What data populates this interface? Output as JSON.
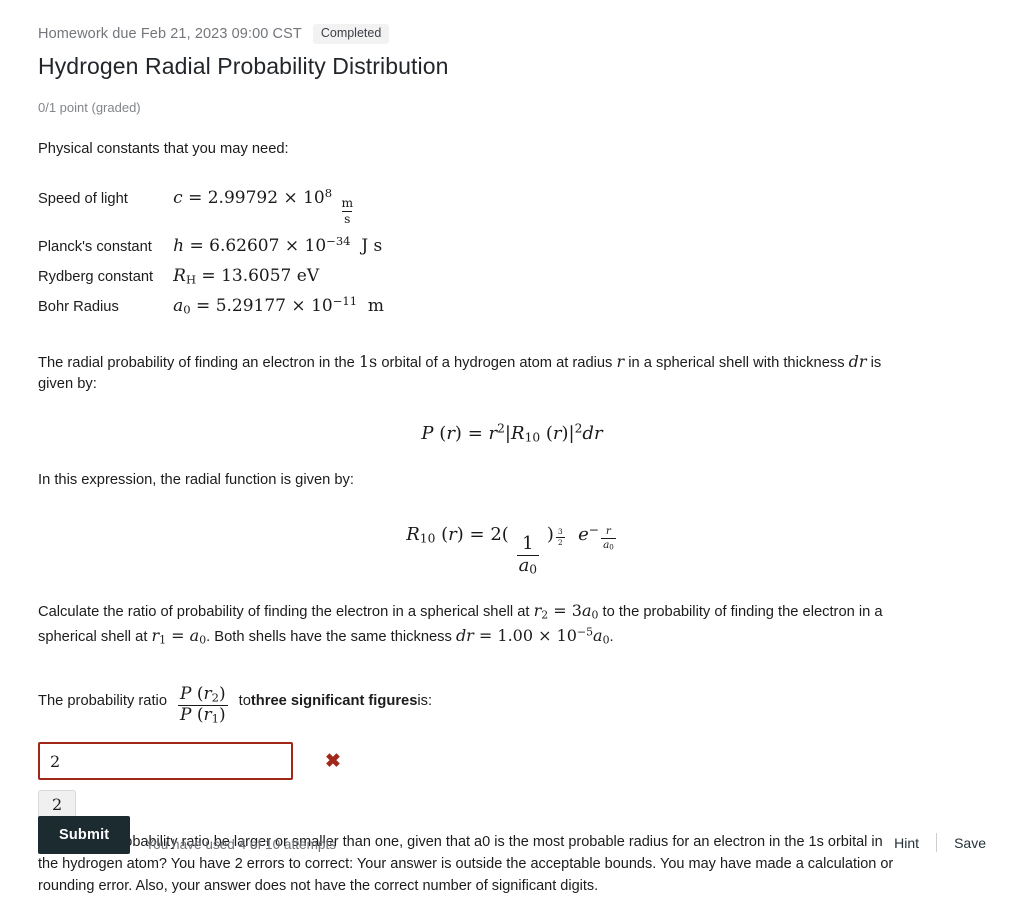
{
  "header": {
    "due_text": "Homework due Feb 21, 2023 09:00 CST",
    "status_badge": "Completed",
    "title": "Hydrogen Radial Probability Distribution",
    "points": "0/1 point (graded)"
  },
  "intro": {
    "constants_heading": "Physical constants that you may need:"
  },
  "constants": [
    {
      "label": "Speed of light",
      "symbol": "c",
      "value": "2.99792 × 10⁸ m/s"
    },
    {
      "label": "Planck's constant",
      "symbol": "h",
      "value": "6.62607 × 10⁻³⁴ J s"
    },
    {
      "label": "Rydberg constant",
      "symbol": "R_H",
      "value": "13.6057 eV"
    },
    {
      "label": "Bohr Radius",
      "symbol": "a_0",
      "value": "5.29177 × 10⁻¹¹ m"
    }
  ],
  "problem": {
    "paragraph1_a": "The radial probability of finding an electron in the ",
    "paragraph1_orbital": "1s",
    "paragraph1_b": " orbital of a hydrogen atom at radius ",
    "paragraph1_r": "r",
    "paragraph1_c": " in a spherical shell with thickness ",
    "paragraph1_dr": "dr",
    "paragraph1_d": " is given by:",
    "equation1": "P (r) = r² |R₁₀ (r)|² dr",
    "paragraph2": "In this expression, the radial function is given by:",
    "equation2": "R₁₀ (r) = 2(1/a₀)^(3/2) e^(−r/a₀)",
    "paragraph3_a": "Calculate the ratio of probability of finding the electron in a spherical shell at ",
    "paragraph3_r2": "r₂ = 3a₀",
    "paragraph3_b": " to the probability of finding the electron in a spherical shell at ",
    "paragraph3_r1": "r₁ = a₀",
    "paragraph3_c": ". Both shells have the same thickness ",
    "paragraph3_dr": "dr = 1.00 × 10⁻⁵ a₀",
    "paragraph3_d": "."
  },
  "answer": {
    "prompt_a": "The probability ratio ",
    "prompt_ratio": "P (r₂) / P (r₁)",
    "prompt_b": " to ",
    "prompt_emphasis": "three significant figures",
    "prompt_c": " is:",
    "input_value": "2",
    "input_placeholder": "",
    "result_mark": "✖",
    "previous_answer": "2"
  },
  "feedback": {
    "text": "Should the probability ratio be larger or smaller than one, given that a0 is the most probable radius for an electron in the 1s orbital in the hydrogen atom? You have 2 errors to correct: Your answer is outside the acceptable bounds. You may have made a calculation or rounding error. Also, your answer does not have the correct number of significant digits."
  },
  "footer": {
    "submit_label": "Submit",
    "attempts_text": "You have used 4 of 10 attempts",
    "hint_label": "Hint",
    "save_label": "Save"
  },
  "colors": {
    "error_red": "#a0271a",
    "submit_dark": "#1b2b30",
    "muted_gray": "#73767b",
    "badge_bg": "#f2f2f3"
  }
}
